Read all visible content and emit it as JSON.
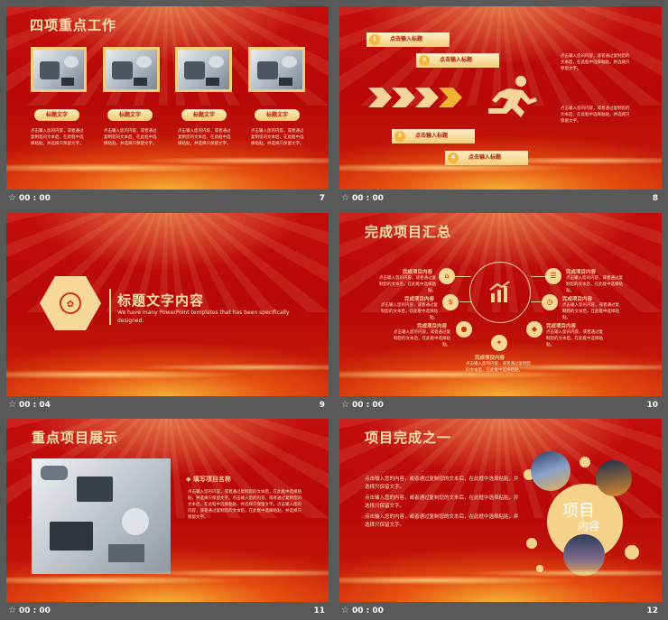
{
  "slides": [
    {
      "number": "7",
      "time": "00 : 00",
      "title": "四项重点工作",
      "pills": [
        "标题文字",
        "标题文字",
        "标题文字",
        "标题文字"
      ],
      "descriptions": [
        "点击输入您的内容，或者通过复制您的文本后，在此框中选择粘贴，并选择只保留文字。",
        "点击输入您的内容，或者通过复制您的文本后，在此框中选择粘贴，并选择只保留文字。",
        "点击输入您的内容，或者通过复制您的文本后，在此框中选择粘贴，并选择只保留文字。",
        "点击输入您的内容，或者通过复制您的文本后，在此框中选择粘贴，并选择只保留文字。"
      ]
    },
    {
      "number": "8",
      "time": "00 : 00",
      "tags": [
        {
          "n": "1",
          "label": "点击输入标题"
        },
        {
          "n": "3",
          "label": "点击输入标题"
        },
        {
          "n": "2",
          "label": "点击输入标题"
        },
        {
          "n": "4",
          "label": "点击输入标题"
        }
      ],
      "desc_top": "点击输入您的内容，或者通过复制您的文本后，在此框中选择粘贴，并选择只保留文字。",
      "desc_bottom": "点击输入您的内容，或者通过复制您的文本后，在此框中选择粘贴，并选择只保留文字。"
    },
    {
      "number": "9",
      "time": "00 : 04",
      "heading": "标题文字内容",
      "subtext": "We have many PowerPoint templates that has been specifically designed."
    },
    {
      "number": "10",
      "time": "00 : 00",
      "title": "完成项目汇总",
      "items": [
        {
          "label": "完成项目内容",
          "desc": "点击输入您的内容，或者通过复制您的文本后，在此框中选择粘贴。"
        },
        {
          "label": "完成项目内容",
          "desc": "点击输入您的内容，或者通过复制您的文本后，在此框中选择粘贴。"
        },
        {
          "label": "完成项目内容",
          "desc": "点击输入您的内容，或者通过复制您的文本后，在此框中选择粘贴。"
        },
        {
          "label": "完成项目内容",
          "desc": "点击输入您的内容，或者通过复制您的文本后，在此框中选择粘贴。"
        },
        {
          "label": "完成项目内容",
          "desc": "点击输入您的内容，或者通过复制您的文本后，在此框中选择粘贴。"
        },
        {
          "label": "完成项目内容",
          "desc": "点击输入您的内容，或者通过复制您的文本后，在此框中选择粘贴。"
        },
        {
          "label": "完成项目内容",
          "desc": "点击输入您的内容，或者通过复制您的文本后，在此框中选择粘贴。"
        }
      ]
    },
    {
      "number": "11",
      "time": "00 : 00",
      "title": "重点项目展示",
      "project_heading": "◆ 填写项目名称",
      "project_text": "点击输入您的内容，或者通过复制您的文本后，在此框中选择粘贴，并选择只保留文字。点击输入您的内容，或者通过复制您的文本后，在此框中选择粘贴，并选择只保留文字。点击输入您的内容，或者通过复制您的文本后，在此框中选择粘贴，并选择只保留文字。"
    },
    {
      "number": "12",
      "time": "00 : 00",
      "title": "项目完成之一",
      "paragraphs": [
        "点击输入您的内容，或者通过复制您的文本后，在此框中选择粘贴，并选择只保留文字。",
        "点击输入您的内容，或者通过复制您的文本后，在此框中选择粘贴，并选择只保留文字。",
        "点击输入您的内容，或者通过复制您的文本后，在此框中选择粘贴，并选择只保留文字。"
      ],
      "circle_big": "项目",
      "circle_small": "内容"
    }
  ],
  "colors": {
    "gold": "#f6d38a",
    "red": "#c40d0d",
    "title": "#ffe0a8"
  },
  "icons": {
    "footer": "star-icon"
  }
}
